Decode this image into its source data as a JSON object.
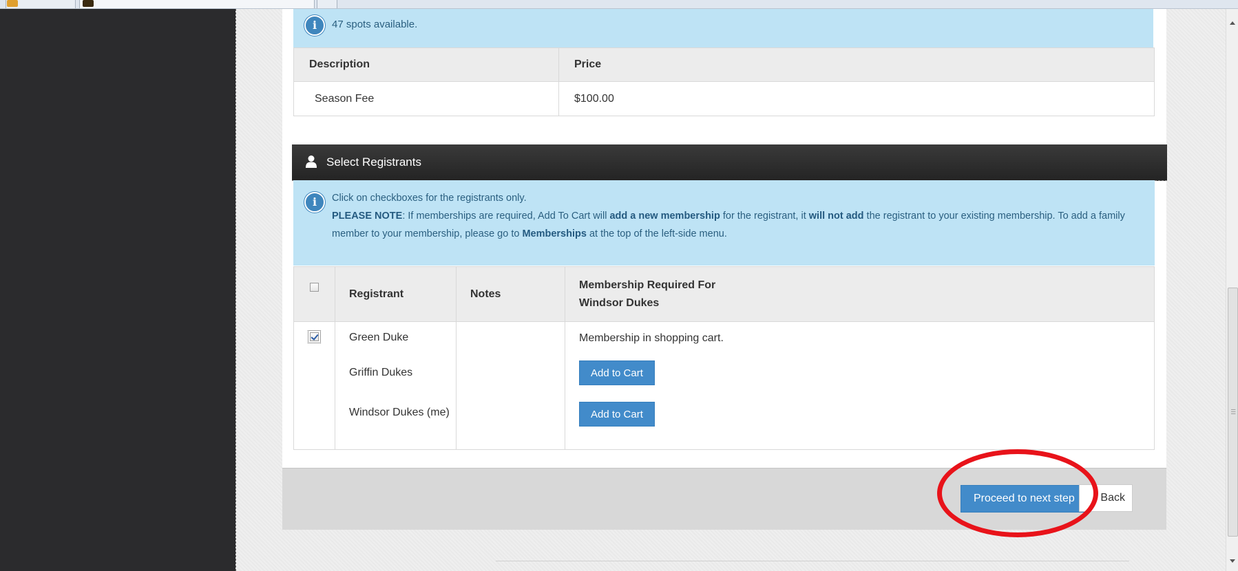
{
  "availability": {
    "spots_text": "47 spots available."
  },
  "price_table": {
    "headers": [
      "Description",
      "Price"
    ],
    "rows": [
      [
        "Season Fee",
        "$100.00"
      ]
    ]
  },
  "registrants_section": {
    "title": "Select Registrants",
    "icon": "user-icon"
  },
  "registrants_info": {
    "line1": "Click on checkboxes for the registrants only.",
    "note_label": "PLEASE NOTE",
    "note_part1": ": If memberships are required, Add To Cart will ",
    "note_bold1": "add a new membership",
    "note_part2": " for the registrant, it ",
    "note_bold2": "will not add",
    "note_part3": " the registrant to your existing membership. To add a family member to your membership, please go to ",
    "note_bold3": "Memberships",
    "note_part4": " at the top of the left-side menu."
  },
  "registrants_table": {
    "header_registrant": "Registrant",
    "header_notes": "Notes",
    "header_membership_line1": "Membership Required For",
    "header_membership_line2": "Windsor Dukes",
    "select_all_checked": false,
    "row_checked": true,
    "registrants": [
      {
        "name": "Green Duke",
        "status": "Membership in shopping cart."
      },
      {
        "name": "Griffin Dukes",
        "button": "Add to Cart"
      },
      {
        "name": "Windsor Dukes (me)",
        "button": "Add to Cart"
      }
    ]
  },
  "footer": {
    "proceed_label": "Proceed to next step",
    "back_label": "Back"
  },
  "colors": {
    "primary_button": "#428bca",
    "info_banner": "#bee3f5",
    "highlight_ellipse": "#e8131a",
    "sidebar": "#2b2b2d"
  }
}
